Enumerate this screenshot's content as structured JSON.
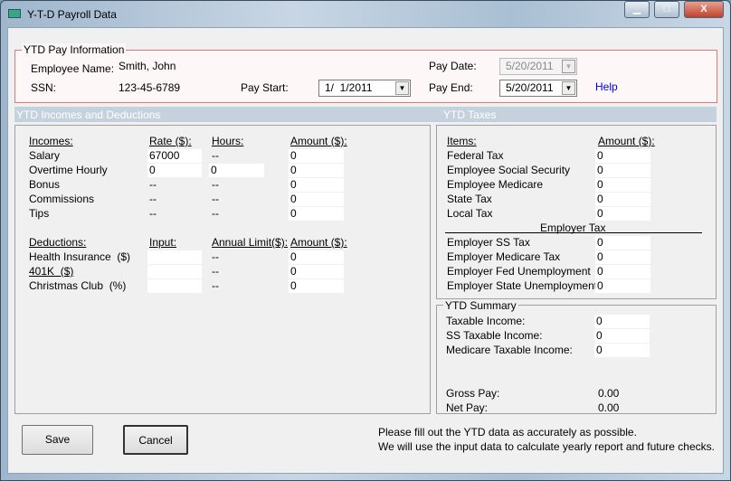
{
  "window": {
    "title": "Y-T-D Payroll Data",
    "minimize": "▁",
    "maximize": "□",
    "close": "X"
  },
  "pay_info": {
    "legend": "YTD Pay Information",
    "employee_name_label": "Employee Name:",
    "employee_name": "Smith, John",
    "ssn_label": "SSN:",
    "ssn": "123-45-6789",
    "pay_start_label": "Pay Start:",
    "pay_start": "1/  1/2011",
    "pay_date_label": "Pay Date:",
    "pay_date": "5/20/2011",
    "pay_end_label": "Pay End:",
    "pay_end": "5/20/2011",
    "help": "Help"
  },
  "incomes": {
    "section_title": "YTD Incomes and Deductions",
    "headers": [
      "Incomes:",
      "Rate ($):",
      "Hours:",
      "Amount ($):"
    ],
    "rows": [
      {
        "label": "Salary",
        "rate": "67000",
        "hours": "--",
        "amount": "0"
      },
      {
        "label": "Overtime Hourly",
        "rate": "0",
        "hours": "0",
        "amount": "0"
      },
      {
        "label": "Bonus",
        "rate": "--",
        "hours": "--",
        "amount": "0"
      },
      {
        "label": "Commissions",
        "rate": "--",
        "hours": "--",
        "amount": "0"
      },
      {
        "label": "Tips",
        "rate": "--",
        "hours": "--",
        "amount": "0"
      }
    ]
  },
  "deductions": {
    "headers": [
      "Deductions:",
      "Input:",
      "Annual Limit($):",
      "Amount ($):"
    ],
    "rows": [
      {
        "label": "Health Insurance  ($)",
        "input": "",
        "limit": "--",
        "amount": "0"
      },
      {
        "label": "401K  ($)",
        "input": "",
        "limit": "--",
        "amount": "0"
      },
      {
        "label": "Christmas Club  (%)",
        "input": "",
        "limit": "--",
        "amount": "0"
      }
    ]
  },
  "taxes": {
    "section_title": "YTD Taxes",
    "headers": [
      "Items:",
      "Amount ($):"
    ],
    "rows": [
      {
        "label": "Federal Tax",
        "amount": "0"
      },
      {
        "label": "Employee Social Security",
        "amount": "0"
      },
      {
        "label": "Employee Medicare",
        "amount": "0"
      },
      {
        "label": "State Tax",
        "amount": "0"
      },
      {
        "label": "Local Tax",
        "amount": "0"
      }
    ],
    "employer_title": "Employer Tax",
    "employer_rows": [
      {
        "label": "Employer SS Tax",
        "amount": "0"
      },
      {
        "label": "Employer Medicare Tax",
        "amount": "0"
      },
      {
        "label": "Employer Fed Unemployment",
        "amount": "0"
      },
      {
        "label": "Employer State Unemployment",
        "amount": "0"
      }
    ]
  },
  "summary": {
    "legend": "YTD Summary",
    "rows": [
      {
        "label": "Taxable Income:",
        "value": "0"
      },
      {
        "label": "SS Taxable Income:",
        "value": "0"
      },
      {
        "label": "Medicare Taxable Income:",
        "value": "0"
      }
    ],
    "gross_label": "Gross Pay:",
    "gross": "0.00",
    "net_label": "Net Pay:",
    "net": "0.00"
  },
  "footer": {
    "save": "Save",
    "cancel": "Cancel",
    "note1": "Please fill out the YTD data as accurately as possible.",
    "note2": "We will use the input data to calculate yearly report and future checks."
  }
}
